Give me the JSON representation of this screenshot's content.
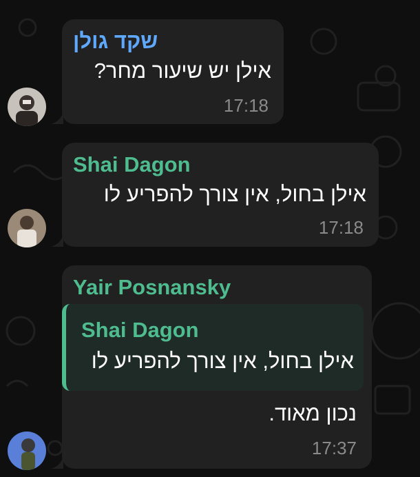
{
  "messages": [
    {
      "sender": "שקד גולן",
      "sender_color": "#5fa8ff",
      "text": "אילן יש שיעור מחר?",
      "time": "17:18"
    },
    {
      "sender": "Shai Dagon",
      "sender_color": "#4fbc8f",
      "text": "אילן בחול, אין צורך להפריע לו",
      "time": "17:18"
    },
    {
      "sender": "Yair Posnansky",
      "sender_color": "#4fbc8f",
      "quote": {
        "sender": "Shai Dagon",
        "text": "אילן בחול, אין צורך להפריע לו"
      },
      "text": "נכון מאוד.",
      "time": "17:37"
    }
  ],
  "colors": {
    "background": "#0f0f0f",
    "bubble": "#212121",
    "quote_bar": "#4fbc8f"
  }
}
